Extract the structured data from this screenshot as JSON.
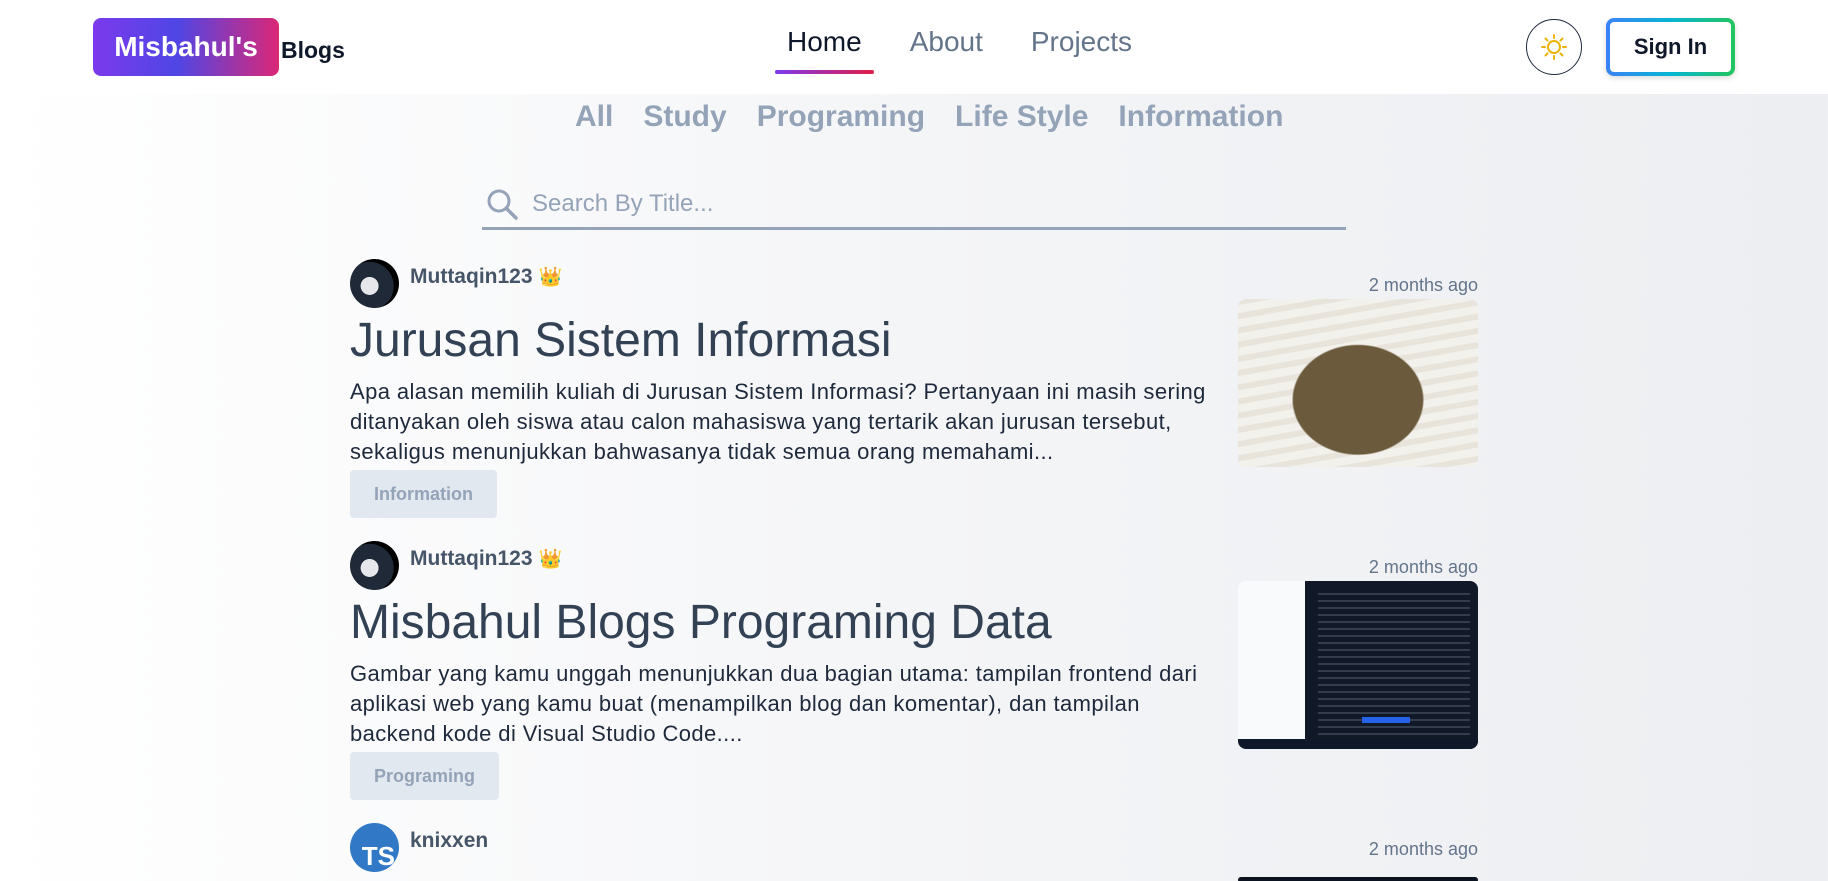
{
  "header": {
    "logo_badge": "Misbahul's",
    "logo_text": "Blogs",
    "nav": [
      {
        "label": "Home",
        "active": true
      },
      {
        "label": "About",
        "active": false
      },
      {
        "label": "Projects",
        "active": false
      }
    ],
    "theme_icon": "sun-icon",
    "signin_label": "Sign In"
  },
  "categories": [
    "All",
    "Study",
    "Programing",
    "Life Style",
    "Information"
  ],
  "search": {
    "placeholder": "Search By Title..."
  },
  "posts": [
    {
      "author": "Muttaqin123",
      "author_badge": "crown-icon",
      "time": "2 months ago",
      "title": "Jurusan Sistem Informasi",
      "excerpt": "Apa alasan memilih kuliah di Jurusan Sistem Informasi? Pertanyaan ini masih sering ditanyakan oleh siswa atau calon mahasiswa yang tertarik akan jurusan tersebut, sekaligus menunjukkan bahwasanya tidak semua orang memahami...",
      "tag": "Information"
    },
    {
      "author": "Muttaqin123",
      "author_badge": "crown-icon",
      "time": "2 months ago",
      "title": "Misbahul Blogs Programing Data",
      "excerpt": "Gambar yang kamu unggah menunjukkan dua bagian utama: tampilan frontend dari aplikasi web yang kamu buat (menampilkan blog dan komentar), dan tampilan backend kode di Visual Studio Code....",
      "tag": "Programing"
    },
    {
      "author": "knixxen",
      "avatar_text": "TS",
      "time": "2 months ago"
    }
  ],
  "colors": {
    "accent_gradient_start": "#7c3aed",
    "accent_gradient_end": "#e11d48",
    "signin_border_start": "#3b82f6",
    "signin_border_end": "#22c55e"
  }
}
